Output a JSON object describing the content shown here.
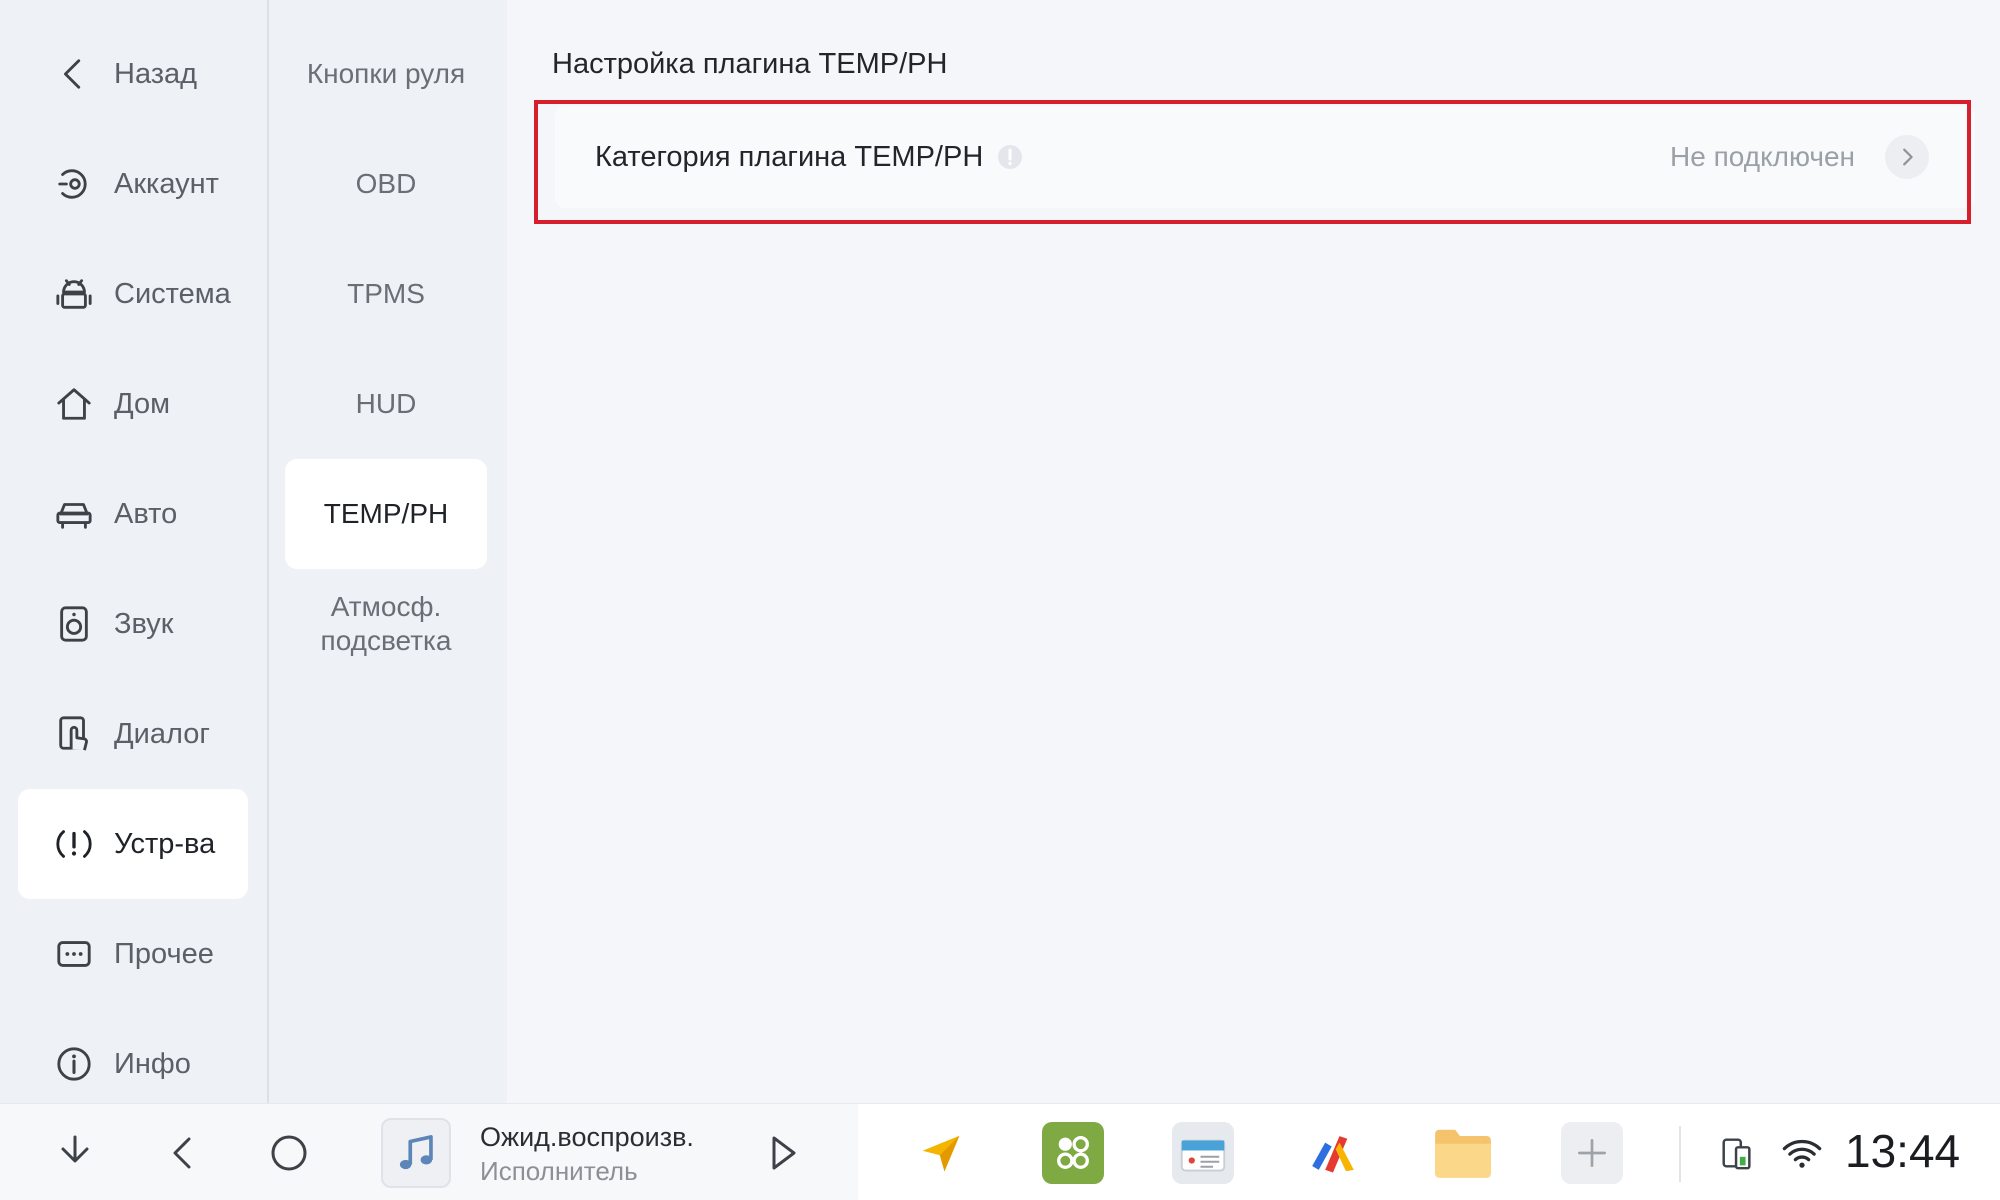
{
  "sidebar": {
    "items": [
      {
        "label": "Назад",
        "icon": "back-chevron-icon"
      },
      {
        "label": "Аккаунт",
        "icon": "account-icon"
      },
      {
        "label": "Система",
        "icon": "android-system-icon"
      },
      {
        "label": "Дом",
        "icon": "home-icon"
      },
      {
        "label": "Авто",
        "icon": "car-icon"
      },
      {
        "label": "Звук",
        "icon": "speaker-icon"
      },
      {
        "label": "Диалог",
        "icon": "touch-hand-icon"
      },
      {
        "label": "Устр-ва",
        "icon": "devices-alert-icon",
        "active": true
      },
      {
        "label": "Прочее",
        "icon": "more-dots-icon"
      },
      {
        "label": "Инфо",
        "icon": "info-icon"
      }
    ]
  },
  "subnav": {
    "items": [
      {
        "label": "Кнопки руля"
      },
      {
        "label": "OBD"
      },
      {
        "label": "TPMS"
      },
      {
        "label": "HUD"
      },
      {
        "label": "TEMP/PH",
        "active": true
      },
      {
        "label": "Атмосф. подсветка"
      }
    ]
  },
  "content": {
    "title": "Настройка плагина TEMP/PH",
    "setting": {
      "label": "Категория плагина TEMP/PH",
      "status": "Не подключен"
    }
  },
  "taskbar": {
    "media": {
      "title": "Ожид.воспроизв.",
      "artist": "Исполнитель"
    },
    "apps": [
      "navigation-arrow-icon",
      "apps-grid-icon",
      "radio-icon",
      "yandex-icon",
      "folder-icon",
      "add-app-icon"
    ],
    "clock": "13:44"
  },
  "colors": {
    "highlight": "#d61f2c",
    "active_bg": "#ffffff",
    "sidebar_bg": "#eef1f5"
  }
}
